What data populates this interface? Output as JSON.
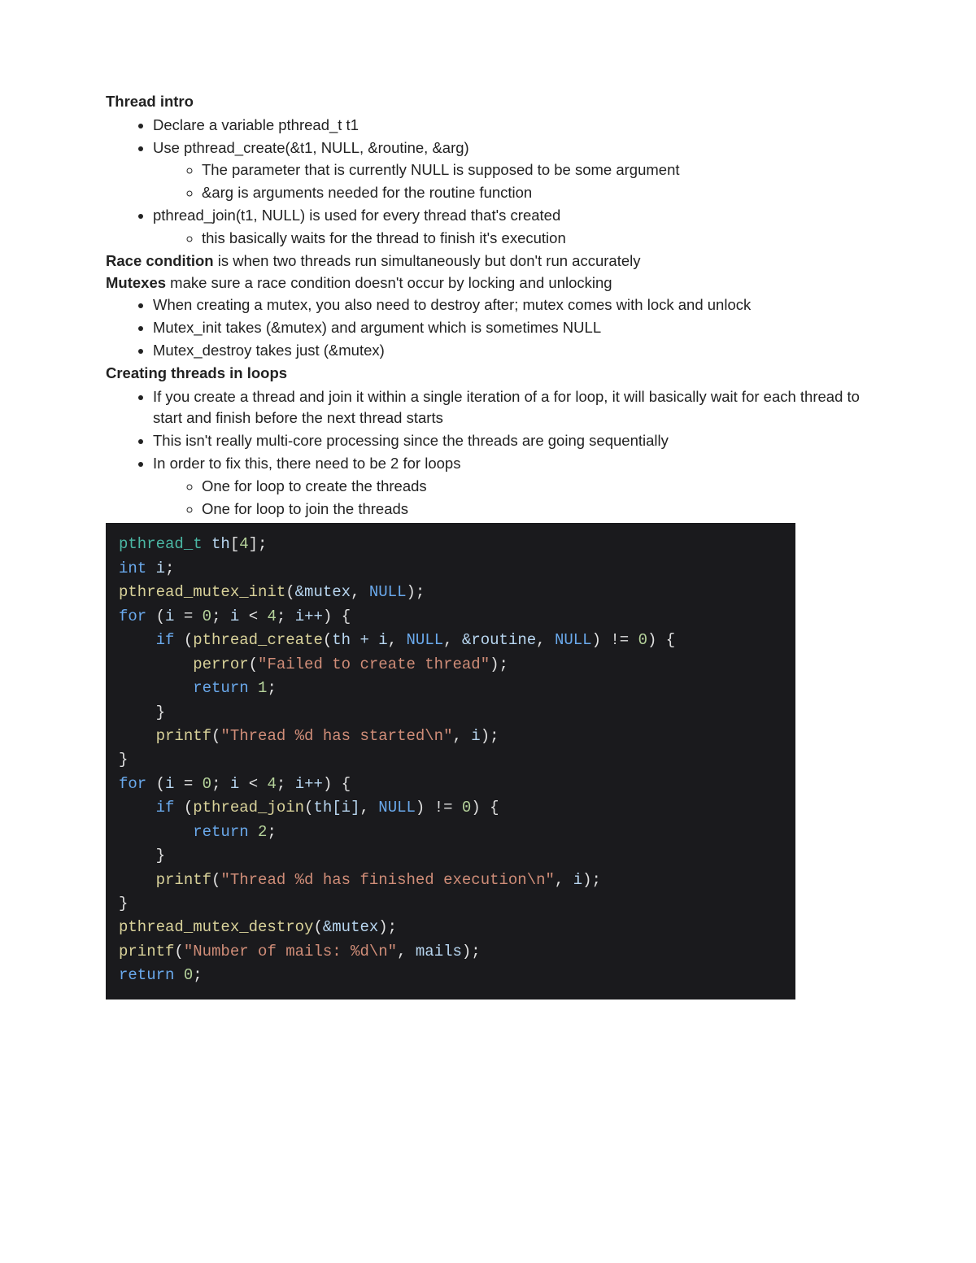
{
  "s1": {
    "heading": "Thread intro",
    "items": [
      "Declare a variable pthread_t t1",
      "Use pthread_create(&t1, NULL, &routine, &arg)",
      "pthread_join(t1, NULL) is used for every thread that's created"
    ],
    "sub1": [
      "The parameter that is currently NULL is supposed to be some argument",
      "&arg is arguments needed for the routine function"
    ],
    "sub2": [
      "this basically waits for the thread to finish it's execution"
    ]
  },
  "race": {
    "bold": "Race condition",
    "rest": " is when two threads run simultaneously but don't run accurately"
  },
  "mutex": {
    "bold": "Mutexes",
    "rest": " make sure a race condition doesn't occur by locking and unlocking",
    "items": [
      "When creating a mutex, you also need to destroy after; mutex comes with lock and unlock",
      "Mutex_init takes (&mutex) and argument which is sometimes NULL",
      "Mutex_destroy takes just (&mutex)"
    ]
  },
  "loops": {
    "heading": "Creating threads in loops",
    "items": [
      "If you create a thread and join it within a single iteration of a for loop, it will basically wait for each thread to start and finish before the next thread starts",
      "This isn't really multi-core processing since the threads are going sequentially",
      "In order to fix this, there need to be 2 for loops"
    ],
    "sub": [
      "One for loop to create the threads",
      "One for loop to join the threads"
    ]
  },
  "code": {
    "l01_type": "pthread_t",
    "l01_var": "th",
    "l01_num": "4",
    "l02_type": "int",
    "l02_var": "i",
    "l03_fn": "pthread_mutex_init",
    "l03_arg1": "&mutex",
    "l03_null": "NULL",
    "l04_kw": "for",
    "l04_i": "i",
    "l04_z": "0",
    "l04_lt": "4",
    "l04_inc": "i++",
    "l05_kw": "if",
    "l05_fn": "pthread_create",
    "l05_a1": "th + i",
    "l05_null": "NULL",
    "l05_a3": "&routine",
    "l05_null2": "NULL",
    "l05_z": "0",
    "l06_fn": "perror",
    "l06_str": "\"Failed to create thread\"",
    "l07_kw": "return",
    "l07_n": "1",
    "l09_fn": "printf",
    "l09_str": "\"Thread %d has started\\n\"",
    "l09_i": "i",
    "l11_kw": "for",
    "l11_i": "i",
    "l11_z": "0",
    "l11_lt": "4",
    "l11_inc": "i++",
    "l12_kw": "if",
    "l12_fn": "pthread_join",
    "l12_a1": "th[i]",
    "l12_null": "NULL",
    "l12_z": "0",
    "l13_kw": "return",
    "l13_n": "2",
    "l15_fn": "printf",
    "l15_str": "\"Thread %d has finished execution\\n\"",
    "l15_i": "i",
    "l17_fn": "pthread_mutex_destroy",
    "l17_arg": "&mutex",
    "l18_fn": "printf",
    "l18_str": "\"Number of mails: %d\\n\"",
    "l18_arg": "mails",
    "l19_kw": "return",
    "l19_n": "0"
  }
}
